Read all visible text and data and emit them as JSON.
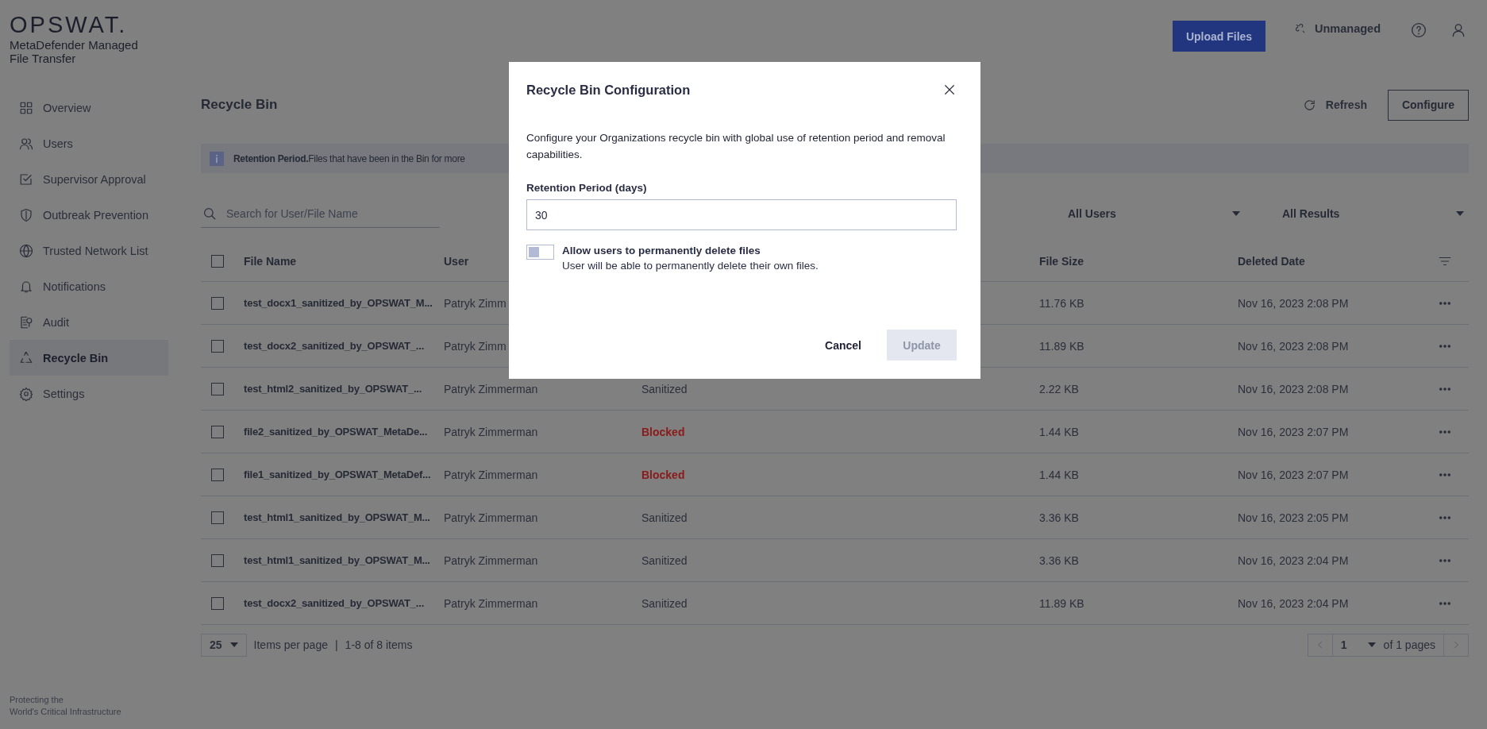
{
  "brand": {
    "logo": "OPSWAT.",
    "product_lines": [
      "MetaDefender Managed",
      "File Transfer"
    ],
    "tagline_lines": [
      "Protecting the",
      "World's Critical Infrastructure"
    ]
  },
  "sidebar": {
    "items": [
      {
        "label": "Overview",
        "selected": false
      },
      {
        "label": "Users",
        "selected": false
      },
      {
        "label": "Supervisor Approval",
        "selected": false
      },
      {
        "label": "Outbreak Prevention",
        "selected": false
      },
      {
        "label": "Trusted Network List",
        "selected": false
      },
      {
        "label": "Notifications",
        "selected": false
      },
      {
        "label": "Audit",
        "selected": false
      },
      {
        "label": "Recycle Bin",
        "selected": true
      },
      {
        "label": "Settings",
        "selected": false
      }
    ]
  },
  "header": {
    "upload_button": "Upload Files",
    "status": "Unmanaged"
  },
  "page": {
    "title": "Recycle Bin",
    "refresh": "Refresh",
    "configure": "Configure",
    "banner": "**Retention Period.**Files that have been in the Bin for more"
  },
  "search": {
    "placeholder": "Search for User/File Name"
  },
  "filters": [
    {
      "value": "All Users"
    },
    {
      "value": "All Results"
    }
  ],
  "table": {
    "select_all_checked": false,
    "columns": [
      "File Name",
      "User",
      "File Size",
      "Deleted Date"
    ],
    "rows": [
      {
        "checked": false,
        "file_name": "test_docx1_sanitized_by_OPSWAT_M...",
        "user": "Patryk Zimm",
        "file_size": "11.76 KB",
        "deleted_date": "Nov 16, 2023 2:08 PM"
      },
      {
        "checked": false,
        "file_name": "test_docx2_sanitized_by_OPSWAT_...",
        "user": "Patryk Zimm",
        "file_size": "11.89 KB",
        "deleted_date": "Nov 16, 2023 2:08 PM"
      },
      {
        "checked": false,
        "file_name": "test_html2_sanitized_by_OPSWAT_...",
        "user": "Patryk Zimmerman",
        "result": {
          "text": "Sanitized",
          "color": "#2b2e3b"
        },
        "file_size": "2.22 KB",
        "deleted_date": "Nov 16, 2023 2:08 PM"
      },
      {
        "checked": false,
        "file_name": "file2_sanitized_by_OPSWAT_MetaDe...",
        "user": "Patryk Zimmerman",
        "result": {
          "text": "Blocked",
          "color": "#8b1a1a"
        },
        "file_size": "1.44 KB",
        "deleted_date": "Nov 16, 2023 2:07 PM"
      },
      {
        "checked": false,
        "file_name": "file1_sanitized_by_OPSWAT_MetaDef...",
        "user": "Patryk Zimmerman",
        "result": {
          "text": "Blocked",
          "color": "#8b1a1a"
        },
        "file_size": "1.44 KB",
        "deleted_date": "Nov 16, 2023 2:07 PM"
      },
      {
        "checked": false,
        "file_name": "test_html1_sanitized_by_OPSWAT_M...",
        "user": "Patryk Zimmerman",
        "result": {
          "text": "Sanitized",
          "color": "#2b2e3b"
        },
        "file_size": "3.36 KB",
        "deleted_date": "Nov 16, 2023 2:05 PM"
      },
      {
        "checked": false,
        "file_name": "test_html1_sanitized_by_OPSWAT_M...",
        "user": "Patryk Zimmerman",
        "result": {
          "text": "Sanitized",
          "color": "#2b2e3b"
        },
        "file_size": "3.36 KB",
        "deleted_date": "Nov 16, 2023 2:04 PM"
      },
      {
        "checked": false,
        "file_name": "test_docx2_sanitized_by_OPSWAT_...",
        "user": "Patryk Zimmerman",
        "result": {
          "text": "Sanitized",
          "color": "#2b2e3b"
        },
        "file_size": "11.89 KB",
        "deleted_date": "Nov 16, 2023 2:04 PM"
      }
    ]
  },
  "pagination": {
    "page_size": "25",
    "items_label": "Items per page",
    "separator": "|",
    "range": "1-8 of 8 items",
    "page": "1",
    "page_total": "of 1 pages"
  },
  "modal": {
    "title": "Recycle Bin Configuration",
    "description": "Configure your Organizations recycle bin with global use of retention period and removal capabilities.",
    "field_label": "Retention Period (days)",
    "field_value": "30",
    "toggle": {
      "on": false,
      "label": "Allow users to permanently delete files",
      "hint": "User will be able to permanently delete their own files."
    },
    "cancel": "Cancel",
    "update": {
      "label": "Update",
      "disabled": true
    }
  }
}
